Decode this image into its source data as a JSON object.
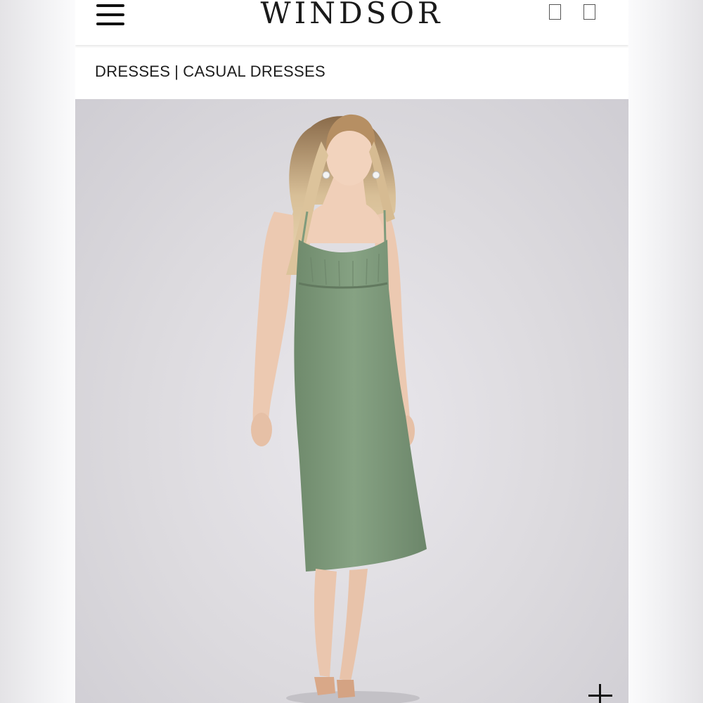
{
  "header": {
    "brand": "WINDSOR",
    "menu_icon": "hamburger-menu-icon",
    "icons": [
      "account-icon",
      "bag-icon"
    ]
  },
  "breadcrumb": {
    "items": [
      "DRESSES",
      "CASUAL DRESSES"
    ],
    "separator": "|"
  },
  "product": {
    "image_subject": "model in sage green ruched bust midi dress",
    "dress_color": "#7f9b7c",
    "zoom_icon": "plus-zoom-icon"
  },
  "colors": {
    "header_bg": "#ffffff",
    "text": "#1d1d1d",
    "photo_bg": "#dcdade"
  }
}
